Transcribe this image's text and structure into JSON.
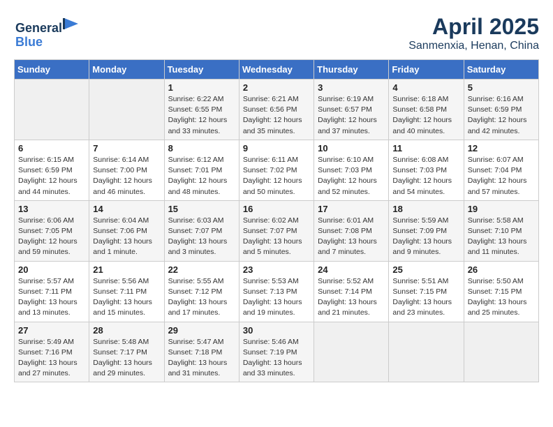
{
  "header": {
    "logo_line1": "General",
    "logo_line2": "Blue",
    "month": "April 2025",
    "location": "Sanmenxia, Henan, China"
  },
  "weekdays": [
    "Sunday",
    "Monday",
    "Tuesday",
    "Wednesday",
    "Thursday",
    "Friday",
    "Saturday"
  ],
  "weeks": [
    [
      {
        "day": "",
        "info": ""
      },
      {
        "day": "",
        "info": ""
      },
      {
        "day": "1",
        "info": "Sunrise: 6:22 AM\nSunset: 6:55 PM\nDaylight: 12 hours\nand 33 minutes."
      },
      {
        "day": "2",
        "info": "Sunrise: 6:21 AM\nSunset: 6:56 PM\nDaylight: 12 hours\nand 35 minutes."
      },
      {
        "day": "3",
        "info": "Sunrise: 6:19 AM\nSunset: 6:57 PM\nDaylight: 12 hours\nand 37 minutes."
      },
      {
        "day": "4",
        "info": "Sunrise: 6:18 AM\nSunset: 6:58 PM\nDaylight: 12 hours\nand 40 minutes."
      },
      {
        "day": "5",
        "info": "Sunrise: 6:16 AM\nSunset: 6:59 PM\nDaylight: 12 hours\nand 42 minutes."
      }
    ],
    [
      {
        "day": "6",
        "info": "Sunrise: 6:15 AM\nSunset: 6:59 PM\nDaylight: 12 hours\nand 44 minutes."
      },
      {
        "day": "7",
        "info": "Sunrise: 6:14 AM\nSunset: 7:00 PM\nDaylight: 12 hours\nand 46 minutes."
      },
      {
        "day": "8",
        "info": "Sunrise: 6:12 AM\nSunset: 7:01 PM\nDaylight: 12 hours\nand 48 minutes."
      },
      {
        "day": "9",
        "info": "Sunrise: 6:11 AM\nSunset: 7:02 PM\nDaylight: 12 hours\nand 50 minutes."
      },
      {
        "day": "10",
        "info": "Sunrise: 6:10 AM\nSunset: 7:03 PM\nDaylight: 12 hours\nand 52 minutes."
      },
      {
        "day": "11",
        "info": "Sunrise: 6:08 AM\nSunset: 7:03 PM\nDaylight: 12 hours\nand 54 minutes."
      },
      {
        "day": "12",
        "info": "Sunrise: 6:07 AM\nSunset: 7:04 PM\nDaylight: 12 hours\nand 57 minutes."
      }
    ],
    [
      {
        "day": "13",
        "info": "Sunrise: 6:06 AM\nSunset: 7:05 PM\nDaylight: 12 hours\nand 59 minutes."
      },
      {
        "day": "14",
        "info": "Sunrise: 6:04 AM\nSunset: 7:06 PM\nDaylight: 13 hours\nand 1 minute."
      },
      {
        "day": "15",
        "info": "Sunrise: 6:03 AM\nSunset: 7:07 PM\nDaylight: 13 hours\nand 3 minutes."
      },
      {
        "day": "16",
        "info": "Sunrise: 6:02 AM\nSunset: 7:07 PM\nDaylight: 13 hours\nand 5 minutes."
      },
      {
        "day": "17",
        "info": "Sunrise: 6:01 AM\nSunset: 7:08 PM\nDaylight: 13 hours\nand 7 minutes."
      },
      {
        "day": "18",
        "info": "Sunrise: 5:59 AM\nSunset: 7:09 PM\nDaylight: 13 hours\nand 9 minutes."
      },
      {
        "day": "19",
        "info": "Sunrise: 5:58 AM\nSunset: 7:10 PM\nDaylight: 13 hours\nand 11 minutes."
      }
    ],
    [
      {
        "day": "20",
        "info": "Sunrise: 5:57 AM\nSunset: 7:11 PM\nDaylight: 13 hours\nand 13 minutes."
      },
      {
        "day": "21",
        "info": "Sunrise: 5:56 AM\nSunset: 7:11 PM\nDaylight: 13 hours\nand 15 minutes."
      },
      {
        "day": "22",
        "info": "Sunrise: 5:55 AM\nSunset: 7:12 PM\nDaylight: 13 hours\nand 17 minutes."
      },
      {
        "day": "23",
        "info": "Sunrise: 5:53 AM\nSunset: 7:13 PM\nDaylight: 13 hours\nand 19 minutes."
      },
      {
        "day": "24",
        "info": "Sunrise: 5:52 AM\nSunset: 7:14 PM\nDaylight: 13 hours\nand 21 minutes."
      },
      {
        "day": "25",
        "info": "Sunrise: 5:51 AM\nSunset: 7:15 PM\nDaylight: 13 hours\nand 23 minutes."
      },
      {
        "day": "26",
        "info": "Sunrise: 5:50 AM\nSunset: 7:15 PM\nDaylight: 13 hours\nand 25 minutes."
      }
    ],
    [
      {
        "day": "27",
        "info": "Sunrise: 5:49 AM\nSunset: 7:16 PM\nDaylight: 13 hours\nand 27 minutes."
      },
      {
        "day": "28",
        "info": "Sunrise: 5:48 AM\nSunset: 7:17 PM\nDaylight: 13 hours\nand 29 minutes."
      },
      {
        "day": "29",
        "info": "Sunrise: 5:47 AM\nSunset: 7:18 PM\nDaylight: 13 hours\nand 31 minutes."
      },
      {
        "day": "30",
        "info": "Sunrise: 5:46 AM\nSunset: 7:19 PM\nDaylight: 13 hours\nand 33 minutes."
      },
      {
        "day": "",
        "info": ""
      },
      {
        "day": "",
        "info": ""
      },
      {
        "day": "",
        "info": ""
      }
    ]
  ]
}
